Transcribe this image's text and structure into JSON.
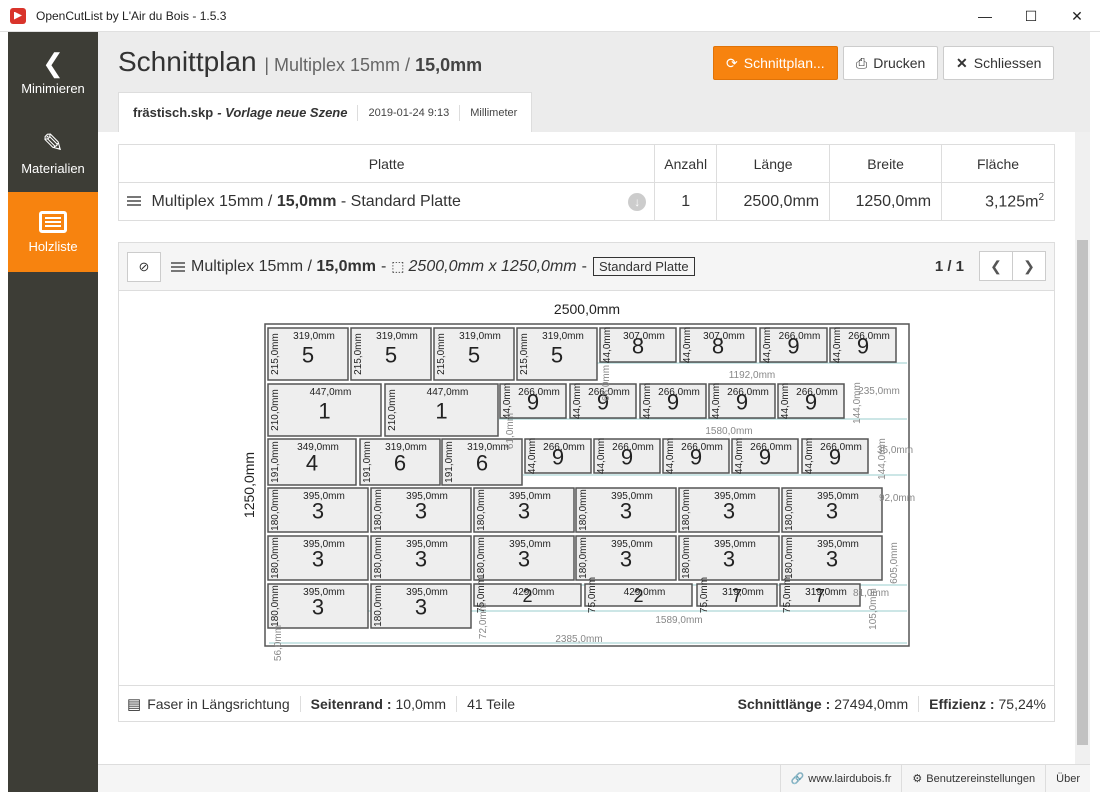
{
  "window": {
    "title": "OpenCutList by L'Air du Bois - 1.5.3"
  },
  "sidebar": {
    "items": [
      {
        "label": "Minimieren",
        "icon": "chevron-left-icon"
      },
      {
        "label": "Materialien",
        "icon": "paint-bucket-icon"
      },
      {
        "label": "Holzliste",
        "icon": "list-icon"
      }
    ]
  },
  "header": {
    "title": "Schnittplan",
    "sub_prefix": "| Multiplex 15mm /",
    "sub_bold": "15,0mm",
    "btn_schnittplan": "Schnittplan...",
    "btn_drucken": "Drucken",
    "btn_schliessen": "Schliessen"
  },
  "tab": {
    "filename": "frästisch.skp",
    "scene": "- Vorlage neue Szene",
    "date": "2019-01-24 9:13",
    "unit": "Millimeter"
  },
  "sheets_table": {
    "headers": [
      "Platte",
      "Anzahl",
      "Länge",
      "Breite",
      "Fläche"
    ],
    "row": {
      "name_prefix": "Multiplex 15mm /",
      "name_bold": "15,0mm",
      "name_suffix": "- Standard Platte",
      "count": "1",
      "length": "2500,0mm",
      "width": "1250,0mm",
      "area": "3,125m",
      "area_sup": "2"
    }
  },
  "panel": {
    "material_prefix": "Multiplex 15mm /",
    "material_bold": "15,0mm",
    "dash": "-",
    "dims": "2500,0mm x 1250,0mm",
    "dash2": "-",
    "tag": "Standard Platte",
    "page": "1 / 1",
    "footer": {
      "grain": "Faser in Längsrichtung",
      "margin_label": "Seitenrand :",
      "margin_value": "10,0mm",
      "parts": "41 Teile",
      "cut_label": "Schnittlänge :",
      "cut_value": "27494,0mm",
      "eff_label": "Effizienz :",
      "eff_value": "75,24%"
    }
  },
  "diagram": {
    "sheet_length": "2500,0mm",
    "sheet_width": "1250,0mm",
    "parts": [
      {
        "n": "5",
        "w": "319,0mm",
        "h": "215,0mm"
      },
      {
        "n": "5",
        "w": "319,0mm",
        "h": "215,0mm"
      },
      {
        "n": "5",
        "w": "319,0mm",
        "h": "215,0mm"
      },
      {
        "n": "5",
        "w": "319,0mm",
        "h": "215,0mm"
      },
      {
        "n": "8",
        "w": "307,0mm",
        "h": "44,0mm"
      },
      {
        "n": "8",
        "w": "307,0mm",
        "h": "44,0mm"
      },
      {
        "n": "9",
        "w": "266,0mm",
        "h": "44,0mm"
      },
      {
        "n": "9",
        "w": "266,0mm",
        "h": "44,0mm"
      },
      {
        "n": "1",
        "w": "447,0mm",
        "h": "210,0mm"
      },
      {
        "n": "1",
        "w": "447,0mm",
        "h": "210,0mm"
      },
      {
        "n": "9",
        "w": "266,0mm",
        "h": "44,0mm"
      },
      {
        "n": "9",
        "w": "266,0mm",
        "h": "44,0mm"
      },
      {
        "n": "9",
        "w": "266,0mm",
        "h": "44,0mm"
      },
      {
        "n": "9",
        "w": "266,0mm",
        "h": "44,0mm"
      },
      {
        "n": "9",
        "w": "266,0mm",
        "h": "44,0mm"
      },
      {
        "n": "4",
        "w": "349,0mm",
        "h": "191,0mm"
      },
      {
        "n": "6",
        "w": "319,0mm",
        "h": "191,0mm"
      },
      {
        "n": "6",
        "w": "319,0mm",
        "h": "191,0mm"
      },
      {
        "n": "9",
        "w": "266,0mm",
        "h": "44,0mm"
      },
      {
        "n": "9",
        "w": "266,0mm",
        "h": "44,0mm"
      },
      {
        "n": "9",
        "w": "266,0mm",
        "h": "44,0mm"
      },
      {
        "n": "9",
        "w": "266,0mm",
        "h": "44,0mm"
      },
      {
        "n": "9",
        "w": "266,0mm",
        "h": "44,0mm"
      },
      {
        "n": "3",
        "w": "395,0mm",
        "h": "180,0mm"
      },
      {
        "n": "3",
        "w": "395,0mm",
        "h": "180,0mm"
      },
      {
        "n": "3",
        "w": "395,0mm",
        "h": "180,0mm"
      },
      {
        "n": "3",
        "w": "395,0mm",
        "h": "180,0mm"
      },
      {
        "n": "3",
        "w": "395,0mm",
        "h": "180,0mm"
      },
      {
        "n": "3",
        "w": "395,0mm",
        "h": "180,0mm"
      },
      {
        "n": "3",
        "w": "395,0mm",
        "h": "180,0mm"
      },
      {
        "n": "3",
        "w": "395,0mm",
        "h": "180,0mm"
      },
      {
        "n": "3",
        "w": "395,0mm",
        "h": "180,0mm"
      },
      {
        "n": "3",
        "w": "395,0mm",
        "h": "180,0mm"
      },
      {
        "n": "3",
        "w": "395,0mm",
        "h": "180,0mm"
      },
      {
        "n": "3",
        "w": "395,0mm",
        "h": "180,0mm"
      },
      {
        "n": "3",
        "w": "395,0mm",
        "h": "180,0mm"
      },
      {
        "n": "3",
        "w": "395,0mm",
        "h": "180,0mm"
      },
      {
        "n": "2",
        "w": "429,0mm",
        "h": "75,0mm"
      },
      {
        "n": "2",
        "w": "429,0mm",
        "h": "75,0mm"
      },
      {
        "n": "7",
        "w": "319,0mm",
        "h": "75,0mm"
      },
      {
        "n": "7",
        "w": "319,0mm",
        "h": "75,0mm"
      }
    ],
    "offcut_labels": [
      "1192,0mm",
      "1580,0mm",
      "235,0mm",
      "144,0mm",
      "144,0mm",
      "35,0mm",
      "92,0mm",
      "605,0mm",
      "81,0mm",
      "105,0mm",
      "1589,0mm",
      "2385,0mm",
      "72,0mm",
      "56,0mm",
      "61,0mm",
      "65,0mm"
    ]
  },
  "statusbar": {
    "website": "www.lairdubois.fr",
    "settings": "Benutzereinstellungen",
    "about": "Über"
  }
}
